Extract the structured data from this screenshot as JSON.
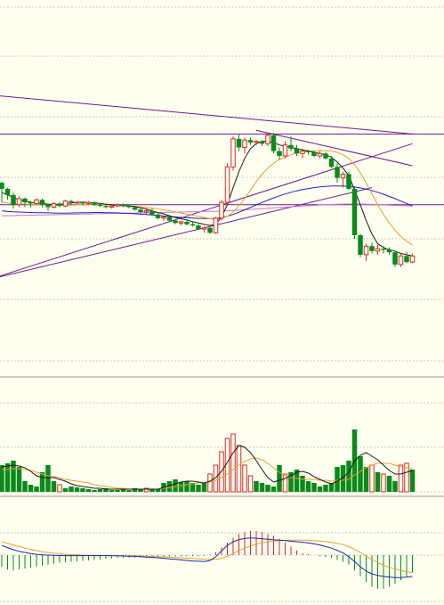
{
  "colors": {
    "background": "#fffff0",
    "up_candle": "#d42a2a",
    "down_candle": "#0a8a1a",
    "ma_short": "#1a1a1a",
    "ma_mid": "#e8a030",
    "ma_long": "#2020c0",
    "ma_extra": "#d070d0",
    "trendline": "#6a1a8a",
    "grid": "#c8c8c8",
    "macd_dif": "#1a2aa0",
    "macd_dea": "#e8a030"
  },
  "chart_data": [
    {
      "type": "candlestick",
      "title": "",
      "grid": true,
      "candles": [
        [
          246,
          247,
          230,
          241
        ],
        [
          241,
          242,
          232,
          236
        ],
        [
          236,
          238,
          225,
          228
        ],
        [
          228,
          235,
          226,
          233
        ],
        [
          233,
          234,
          226,
          230
        ],
        [
          230,
          231,
          226,
          229
        ],
        [
          229,
          233,
          228,
          232
        ],
        [
          232,
          233,
          226,
          228
        ],
        [
          228,
          229,
          223,
          226
        ],
        [
          226,
          230,
          225,
          229
        ],
        [
          229,
          230,
          226,
          227
        ],
        [
          227,
          232,
          226,
          231
        ],
        [
          231,
          232,
          228,
          230
        ],
        [
          230,
          231,
          229,
          230
        ],
        [
          230,
          231,
          228,
          229
        ],
        [
          229,
          231,
          228,
          230
        ],
        [
          230,
          231,
          227,
          228
        ],
        [
          228,
          229,
          226,
          227
        ],
        [
          227,
          228,
          225,
          226
        ],
        [
          226,
          228,
          225,
          227
        ],
        [
          227,
          229,
          226,
          228
        ],
        [
          228,
          229,
          226,
          227
        ],
        [
          227,
          228,
          225,
          226
        ],
        [
          226,
          227,
          223,
          224
        ],
        [
          224,
          226,
          221,
          222
        ],
        [
          222,
          224,
          220,
          223
        ],
        [
          223,
          225,
          219,
          220
        ],
        [
          220,
          221,
          216,
          217
        ],
        [
          217,
          219,
          215,
          218
        ],
        [
          218,
          219,
          214,
          215
        ],
        [
          215,
          216,
          212,
          213
        ],
        [
          213,
          215,
          211,
          214
        ],
        [
          214,
          216,
          211,
          212
        ],
        [
          212,
          214,
          210,
          211
        ],
        [
          211,
          212,
          207,
          208
        ],
        [
          208,
          210,
          205,
          209
        ],
        [
          209,
          210,
          204,
          205
        ],
        [
          205,
          218,
          204,
          217
        ],
        [
          217,
          232,
          215,
          230
        ],
        [
          230,
          262,
          228,
          259
        ],
        [
          259,
          284,
          256,
          282
        ],
        [
          282,
          286,
          272,
          275
        ],
        [
          275,
          283,
          270,
          281
        ],
        [
          281,
          283,
          277,
          279
        ],
        [
          279,
          281,
          277,
          280
        ],
        [
          280,
          281,
          276,
          278
        ],
        [
          278,
          287,
          276,
          285
        ],
        [
          285,
          287,
          270,
          272
        ],
        [
          272,
          275,
          265,
          268
        ],
        [
          268,
          280,
          266,
          277
        ],
        [
          277,
          284,
          272,
          274
        ],
        [
          274,
          277,
          268,
          270
        ],
        [
          270,
          274,
          266,
          272
        ],
        [
          272,
          273,
          269,
          271
        ],
        [
          271,
          272,
          267,
          268
        ],
        [
          268,
          272,
          266,
          270
        ],
        [
          270,
          271,
          265,
          266
        ],
        [
          266,
          268,
          258,
          259
        ],
        [
          259,
          262,
          246,
          250
        ],
        [
          250,
          255,
          242,
          253
        ],
        [
          253,
          255,
          240,
          241
        ],
        [
          241,
          243,
          200,
          203
        ],
        [
          203,
          204,
          185,
          187
        ],
        [
          187,
          196,
          182,
          194
        ],
        [
          194,
          197,
          188,
          190
        ],
        [
          190,
          195,
          187,
          192
        ],
        [
          192,
          194,
          188,
          191
        ],
        [
          191,
          193,
          187,
          189
        ],
        [
          189,
          190,
          177,
          179
        ],
        [
          179,
          188,
          177,
          186
        ],
        [
          186,
          189,
          180,
          181
        ],
        [
          181,
          188,
          180,
          186
        ]
      ],
      "ma_short": [
        238,
        236,
        234,
        232,
        231,
        230,
        229.5,
        229,
        228.5,
        228,
        228,
        229,
        229.5,
        230,
        230,
        229.8,
        229.5,
        229,
        228.5,
        228,
        227.5,
        227.2,
        227,
        226.5,
        225.5,
        224.5,
        223,
        221.5,
        220.5,
        219,
        217.5,
        216.5,
        215.5,
        214,
        213,
        212,
        211,
        212,
        218,
        228,
        242,
        255,
        266,
        274,
        278,
        280,
        280,
        279,
        277,
        276,
        275,
        274,
        273,
        272,
        271,
        270,
        269,
        267,
        263,
        258,
        252,
        240,
        228,
        215,
        204,
        196,
        193,
        191,
        190,
        188,
        187,
        186
      ],
      "ma_mid": [
        230,
        229.5,
        229,
        228.8,
        228.5,
        228.3,
        228.2,
        228,
        227.8,
        227.7,
        227.6,
        227.6,
        227.7,
        227.8,
        227.9,
        228,
        228,
        227.9,
        227.8,
        227.6,
        227.4,
        227.2,
        227,
        226.7,
        226.3,
        225.8,
        225.2,
        224.5,
        223.8,
        223,
        222.1,
        221.2,
        220.3,
        219.4,
        218.5,
        217.5,
        216.6,
        216,
        216.5,
        218.5,
        222,
        227,
        233,
        240,
        247,
        253,
        258,
        262,
        265,
        267,
        269,
        270.5,
        271.5,
        272,
        272.3,
        272.4,
        272.3,
        272,
        271,
        269,
        266,
        261,
        254,
        246,
        237,
        228,
        220,
        213,
        207,
        202,
        198,
        195
      ],
      "ma_long": [
        223,
        222.6,
        222.2,
        222,
        221.8,
        221.6,
        221.5,
        221.4,
        221.3,
        221.2,
        221.1,
        221.1,
        221.2,
        221.3,
        221.4,
        221.5,
        221.6,
        221.6,
        221.5,
        221.4,
        221.3,
        221.1,
        220.9,
        220.6,
        220.3,
        220,
        219.6,
        219.2,
        218.8,
        218.4,
        218,
        217.6,
        217.3,
        217,
        216.8,
        216.7,
        216.6,
        216.8,
        217.4,
        218.5,
        220,
        221.8,
        223.8,
        225.8,
        227.8,
        229.8,
        231.8,
        233.6,
        235.3,
        236.8,
        238.2,
        239.4,
        240.4,
        241.3,
        242,
        242.6,
        243,
        243.3,
        243.4,
        243.3,
        243,
        242.5,
        241.8,
        240.8,
        239.6,
        238.2,
        236.6,
        234.8,
        233,
        231,
        229,
        227
      ],
      "ma_extra": [
        219,
        219,
        219.1,
        219.2,
        219.3,
        219.4,
        219.5,
        219.6,
        219.7,
        219.8,
        219.9,
        220,
        220.1,
        220.2,
        220.3,
        220.4,
        220.5,
        220.6,
        220.7,
        220.8,
        220.9,
        221,
        221.1,
        221.2,
        221.3,
        221.4,
        221.5,
        221.6,
        221.7,
        221.8,
        221.9,
        222,
        222.1,
        222.2,
        222.3,
        222.4,
        222.5,
        222.6,
        222.8,
        223,
        223.3,
        223.6,
        223.9,
        224.2,
        224.5,
        224.8,
        225.1,
        225.4,
        225.7,
        226,
        226.3,
        226.6,
        226.9,
        227.2,
        227.5,
        227.8,
        228,
        228.2,
        228.4,
        228.5,
        228.6,
        228.6,
        228.5,
        228.4,
        228.3,
        228.1,
        227.9,
        227.7,
        227.5,
        227.3,
        227.1,
        226.9
      ],
      "horizontal_lines": [
        286,
        228
      ],
      "trend_lines": [
        {
          "from": [
            -2,
            318
          ],
          "to": [
            71,
            286
          ]
        },
        {
          "from": [
            44,
            289
          ],
          "to": [
            71,
            260
          ]
        },
        {
          "from": [
            -2,
            167
          ],
          "to": [
            64,
            242
          ]
        },
        {
          "from": [
            -2,
            167
          ],
          "to": [
            71,
            278
          ]
        }
      ]
    },
    {
      "type": "bar",
      "title": "",
      "up": [
        false,
        false,
        false,
        false,
        false,
        false,
        false,
        false,
        false,
        false,
        true,
        false,
        false,
        false,
        false,
        false,
        false,
        false,
        false,
        false,
        false,
        false,
        false,
        false,
        false,
        true,
        false,
        false,
        false,
        false,
        false,
        false,
        false,
        false,
        false,
        false,
        true,
        true,
        true,
        true,
        true,
        true,
        true,
        true,
        false,
        false,
        false,
        false,
        false,
        true,
        false,
        false,
        false,
        false,
        false,
        false,
        false,
        false,
        false,
        false,
        false,
        false,
        false,
        false,
        true,
        false,
        true,
        false,
        false,
        true,
        true,
        false
      ],
      "values": [
        30,
        32,
        35,
        28,
        12,
        8,
        6,
        22,
        30,
        12,
        8,
        4,
        6,
        5,
        4,
        3,
        2,
        3,
        4,
        2,
        2,
        3,
        2,
        4,
        3,
        4,
        3,
        3,
        10,
        12,
        14,
        11,
        12,
        10,
        8,
        10,
        20,
        30,
        45,
        60,
        65,
        52,
        30,
        18,
        12,
        10,
        8,
        6,
        30,
        20,
        22,
        25,
        18,
        12,
        10,
        6,
        8,
        10,
        28,
        30,
        35,
        70,
        40,
        28,
        30,
        22,
        20,
        18,
        12,
        30,
        32,
        25
      ],
      "ma5": [
        28,
        29,
        30,
        29,
        27,
        23,
        18,
        16,
        16,
        16,
        14,
        12,
        9,
        7,
        6,
        5,
        4,
        4,
        3,
        3,
        3,
        3,
        3,
        3,
        3,
        3,
        3,
        3,
        5,
        7,
        9,
        11,
        12,
        12,
        11,
        10,
        12,
        16,
        23,
        33,
        44,
        52,
        50,
        44,
        35,
        25,
        16,
        11,
        13,
        15,
        18,
        22,
        23,
        21,
        17,
        14,
        11,
        9,
        12,
        16,
        22,
        35,
        41,
        44,
        40,
        36,
        30,
        24,
        20,
        20,
        22,
        24
      ],
      "ma10": [
        25,
        25,
        26,
        26,
        25,
        24,
        22,
        20,
        18,
        17,
        16,
        14,
        13,
        12,
        11,
        10,
        8,
        7,
        6,
        5,
        4,
        4,
        3,
        3,
        3,
        3,
        3,
        3,
        4,
        5,
        6,
        7,
        8,
        9,
        10,
        10,
        11,
        13,
        16,
        20,
        25,
        30,
        34,
        37,
        38,
        36,
        32,
        27,
        22,
        18,
        16,
        15,
        14,
        14,
        14,
        13,
        13,
        12,
        13,
        13,
        14,
        19,
        23,
        27,
        30,
        32,
        32,
        32,
        30,
        28,
        27,
        26
      ]
    },
    {
      "type": "bar",
      "title": "",
      "macd": [
        -1.2,
        -1.5,
        -1.6,
        -1.5,
        -1.4,
        -1.3,
        -1.2,
        -1.1,
        -1.0,
        -0.9,
        -0.8,
        -0.75,
        -0.7,
        -0.65,
        -0.6,
        -0.55,
        -0.5,
        -0.45,
        -0.4,
        -0.35,
        -0.3,
        -0.28,
        -0.26,
        -0.24,
        -0.22,
        -0.2,
        -0.18,
        -0.17,
        -0.16,
        -0.15,
        -0.14,
        -0.13,
        -0.12,
        -0.11,
        -0.1,
        -0.08,
        0.05,
        0.3,
        0.8,
        1.3,
        1.8,
        2.2,
        2.4,
        2.5,
        2.5,
        2.4,
        2.2,
        2.0,
        1.7,
        1.3,
        0.9,
        0.5,
        0.2,
        0.1,
        0.0,
        -0.1,
        -0.2,
        -0.3,
        -0.5,
        -0.7,
        -1.0,
        -1.6,
        -2.2,
        -2.8,
        -3.3,
        -3.5,
        -3.5,
        -3.3,
        -3.0,
        -2.6,
        -2.2,
        -1.8
      ],
      "dif": [
        1.8,
        1.4,
        1.0,
        0.7,
        0.5,
        0.3,
        0.15,
        0.05,
        0.0,
        -0.05,
        -0.08,
        -0.1,
        -0.1,
        -0.1,
        -0.1,
        -0.1,
        -0.1,
        -0.1,
        -0.1,
        -0.12,
        -0.14,
        -0.16,
        -0.2,
        -0.24,
        -0.3,
        -0.36,
        -0.42,
        -0.5,
        -0.6,
        -0.7,
        -0.8,
        -0.9,
        -1.0,
        -1.1,
        -1.15,
        -1.2,
        -1.0,
        -0.3,
        0.8,
        1.8,
        2.5,
        2.9,
        3.1,
        3.2,
        3.15,
        3.05,
        2.95,
        2.85,
        2.8,
        2.7,
        2.6,
        2.5,
        2.4,
        2.3,
        2.1,
        1.9,
        1.6,
        1.3,
        0.9,
        0.4,
        -0.3,
        -1.2,
        -2.2,
        -3.0,
        -3.5,
        -3.8,
        -4.0,
        -4.1,
        -4.2,
        -4.2,
        -4.1,
        -4.0
      ],
      "dea": [
        2.5,
        2.2,
        1.9,
        1.6,
        1.3,
        1.05,
        0.85,
        0.65,
        0.5,
        0.35,
        0.25,
        0.15,
        0.08,
        0.03,
        0.0,
        -0.02,
        -0.04,
        -0.06,
        -0.07,
        -0.08,
        -0.1,
        -0.12,
        -0.14,
        -0.16,
        -0.19,
        -0.22,
        -0.26,
        -0.3,
        -0.35,
        -0.4,
        -0.46,
        -0.52,
        -0.58,
        -0.64,
        -0.7,
        -0.76,
        -0.8,
        -0.78,
        -0.6,
        -0.2,
        0.3,
        0.8,
        1.3,
        1.7,
        2.05,
        2.3,
        2.5,
        2.6,
        2.7,
        2.75,
        2.78,
        2.8,
        2.8,
        2.78,
        2.72,
        2.64,
        2.52,
        2.38,
        2.2,
        1.95,
        1.6,
        1.1,
        0.5,
        -0.2,
        -0.8,
        -1.4,
        -1.9,
        -2.3,
        -2.6,
        -2.9,
        -3.1,
        -3.3
      ]
    }
  ]
}
